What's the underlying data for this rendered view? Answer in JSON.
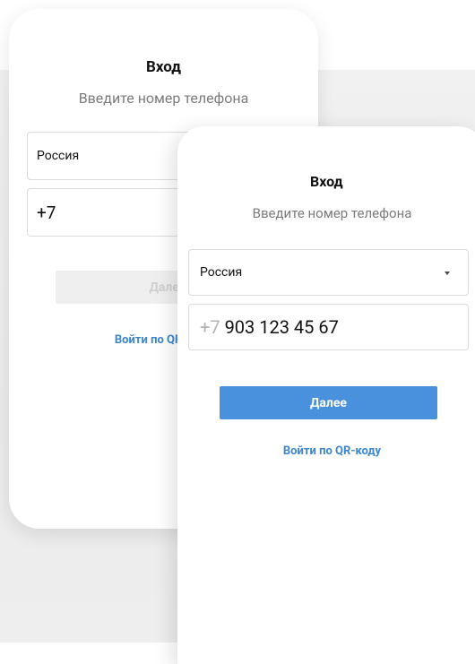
{
  "back_card": {
    "title": "Вход",
    "subtitle": "Введите номер телефона",
    "country": "Россия",
    "phone_prefix": "+7",
    "next_label": "Далее",
    "qr_label": "Войти по QR-коду"
  },
  "front_card": {
    "title": "Вход",
    "subtitle": "Введите номер телефона",
    "country": "Россия",
    "phone_prefix": "+7",
    "phone_number": "903 123 45 67",
    "next_label": "Далее",
    "qr_label": "Войти по QR-коду"
  },
  "colors": {
    "accent": "#4a91dd",
    "link": "#3c86d0",
    "disabled_button": "#efefef"
  },
  "icons": {
    "dropdown": "caret-down-icon"
  }
}
